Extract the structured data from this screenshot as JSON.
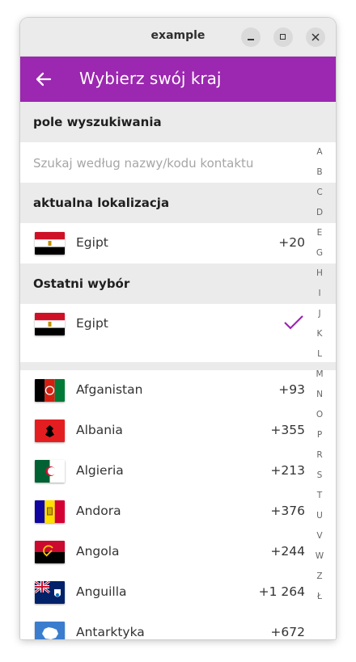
{
  "window": {
    "title": "example"
  },
  "appbar": {
    "title": "Wybierz swój kraj"
  },
  "search": {
    "section_label": "pole wyszukiwania",
    "placeholder": "Szukaj według nazwy/kodu kontaktu"
  },
  "current": {
    "section_label": "aktualna lokalizacja",
    "name": "Egipt",
    "code": "+20"
  },
  "recent": {
    "section_label": "Ostatni wybór",
    "name": "Egipt"
  },
  "countries": [
    {
      "name": "Afganistan",
      "code": "+93",
      "flag": "flag-afghanistan"
    },
    {
      "name": "Albania",
      "code": "+355",
      "flag": "flag-albania"
    },
    {
      "name": "Algieria",
      "code": "+213",
      "flag": "flag-algeria"
    },
    {
      "name": "Andora",
      "code": "+376",
      "flag": "flag-andorra"
    },
    {
      "name": "Angola",
      "code": "+244",
      "flag": "flag-angola"
    },
    {
      "name": "Anguilla",
      "code": "+1 264",
      "flag": "flag-anguilla"
    },
    {
      "name": "Antarktyka",
      "code": "+672",
      "flag": "flag-antarctica"
    }
  ],
  "alphabet": [
    "A",
    "B",
    "C",
    "D",
    "E",
    "G",
    "H",
    "I",
    "J",
    "K",
    "L",
    "M",
    "N",
    "O",
    "P",
    "R",
    "S",
    "T",
    "U",
    "V",
    "W",
    "Z",
    "Ł"
  ],
  "colors": {
    "accent": "#9c27b0",
    "section_bg": "#ebebeb"
  }
}
